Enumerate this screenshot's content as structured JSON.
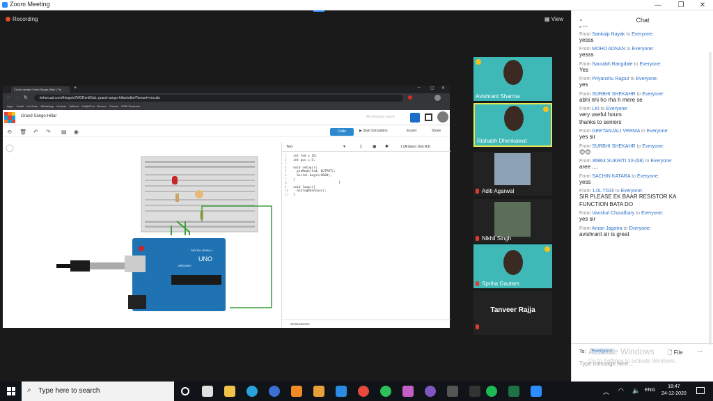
{
  "window": {
    "title": "Zoom Meeting"
  },
  "meeting": {
    "recording_label": "Recording",
    "view_label": "View"
  },
  "browser": {
    "tab_title": "Circuit design Grand Sango-Hillar | Tin",
    "url": "tinkercad.com/things/a7MGRen8GaL-grand-sango-hillar/editel?tenant=circuits",
    "bookmarks": [
      "Apps",
      "Gmail",
      "YouTube",
      "WhatsApp",
      "Hotmax",
      "Wikihat",
      "SwijiMCcs · Review",
      "Classis",
      "8085 Simulator"
    ]
  },
  "tinkercad": {
    "project_name": "Grand Sango-Hillar",
    "saved_status": "All changes saved",
    "code_button": "Code",
    "start_simulation": "Start Simulation",
    "export": "Export",
    "share": "Share",
    "code_mode": "Text",
    "board_select": "1 (Arduino Uno R3)",
    "code_lines": [
      "int led = 10;",
      "int pus = 5;",
      "",
      "void setup(){",
      "  pinMode(led, OUTPUT);",
      "  Serial.begin(9600);",
      "}",
      "",
      "void loop(){",
      "  analogRead(pus);",
      "}"
    ],
    "line_numbers": [
      "1",
      "2",
      "3",
      "4",
      "5",
      "6",
      "7",
      "8",
      "9",
      "10",
      "11"
    ],
    "serial_monitor": "Serial Monitor",
    "arduino_label": "UNO",
    "arduino_brand": "ARDUINO",
    "arduino_digital": "DIGITAL (PWM~)"
  },
  "participants": [
    {
      "name": "Avishrant Sharma",
      "muted": false
    },
    {
      "name": "Rishabh Dhenkawat",
      "muted": false
    },
    {
      "name": "Aditi Agarwal",
      "muted": true
    },
    {
      "name": "Nikhil Singh",
      "muted": true
    },
    {
      "name": "Spriha Gautam",
      "muted": true
    },
    {
      "name": "Tanveer Rajja",
      "muted": true
    }
  ],
  "chat": {
    "title": "Chat",
    "messages": [
      {
        "from": "",
        "to": "",
        "text": "yes"
      },
      {
        "from": "Sankalp Nayak",
        "to": "Everyone",
        "text": "yesss"
      },
      {
        "from": "MOHD ADNAN",
        "to": "Everyone",
        "text": "yesss"
      },
      {
        "from": "Saurabh Rangdale",
        "to": "Everyone",
        "text": "Yes"
      },
      {
        "from": "Priyanshu Rajput",
        "to": "Everyone",
        "text": "yes"
      },
      {
        "from": "SURBHI SHEKAHR",
        "to": "Everyone",
        "text": "abhi nhi ho rha h mere se"
      },
      {
        "from": "LKI",
        "to": "Everyone",
        "text": "very useful hours\nthanks to seniors"
      },
      {
        "from": "GEETANJALI VERMA",
        "to": "Everyone",
        "text": "yes sir"
      },
      {
        "from": "SURBHI SHEKAHR",
        "to": "Everyone",
        "text": "😊😊"
      },
      {
        "from": "36863 SUKRITI XII-(08)",
        "to": "Everyone",
        "text": "aree ...."
      },
      {
        "from": "SACHIN KATARA",
        "to": "Everyone",
        "text": "yess"
      },
      {
        "from": "1.0L TGDi",
        "to": "Everyone",
        "text": "SIR PLEASE EK BAAR RESISTOR KA FUNCTION BATA DO"
      },
      {
        "from": "Vanshul Choudhary",
        "to": "Everyone",
        "text": "yes sir"
      },
      {
        "from": "Aman Jagotra",
        "to": "Everyone",
        "text": "avishrant sir is great"
      }
    ],
    "from_word": "From",
    "to_word": "to",
    "to_label": "To:",
    "to_value": "Everyone",
    "file_label": "File",
    "placeholder": "Type message here...",
    "watermark_line1": "Activate Windows",
    "watermark_line2": "Go to Settings to activate Windows."
  },
  "taskbar": {
    "search_placeholder": "Type here to search",
    "lang": "ENG",
    "time": "18:47",
    "date": "24-12-2020"
  }
}
